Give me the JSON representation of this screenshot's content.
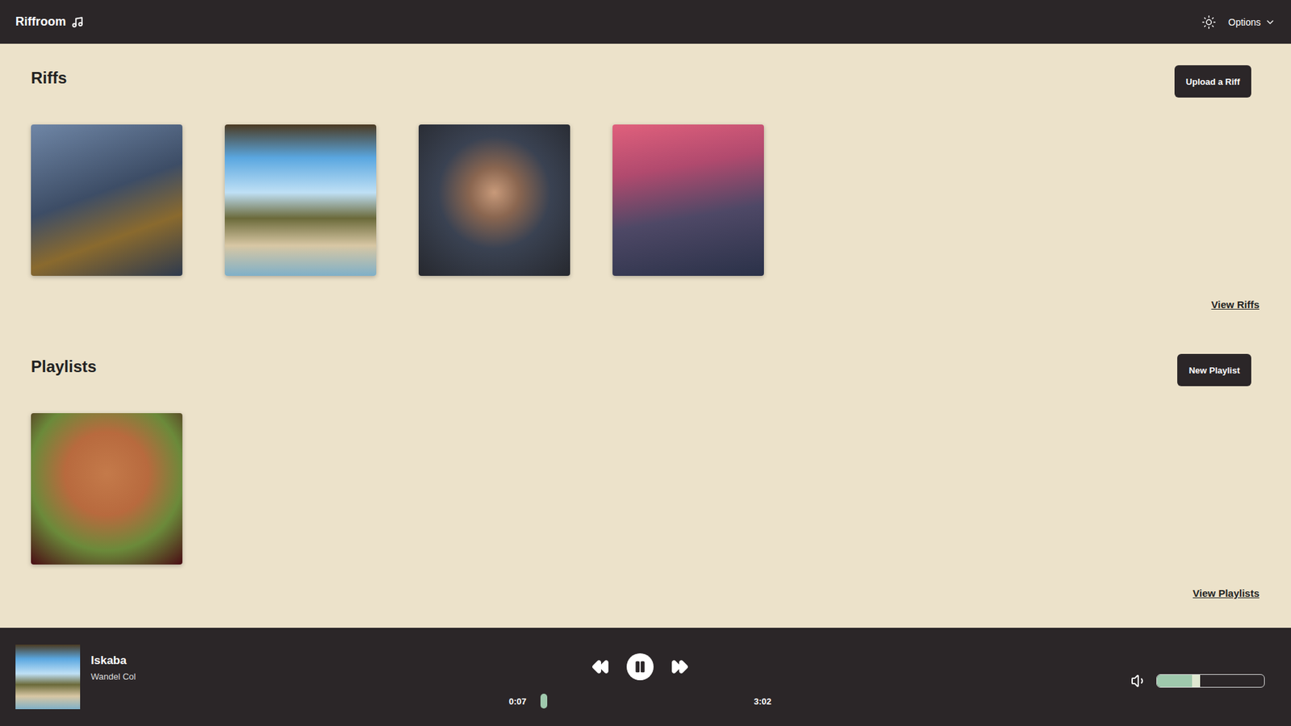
{
  "header": {
    "title": "Riffroom",
    "options": "Options"
  },
  "riffs": {
    "title": "Riffs",
    "button": "Upload a Riff",
    "link": "View Riffs",
    "items": [
      {
        "image": "halo"
      },
      {
        "image": "beach"
      },
      {
        "image": "portrait"
      },
      {
        "image": "mountain"
      }
    ]
  },
  "playlists": {
    "title": "Playlists",
    "button": "New Playlist",
    "link": "View Playlists",
    "items": [
      {
        "image": "cartoon"
      }
    ]
  },
  "player": {
    "title": "Iskaba",
    "artist": "Wandel Col",
    "image": "beach",
    "playing": true,
    "elapsed": "0:07",
    "duration": "3:02",
    "progress": 0.04,
    "volume": 0.4
  }
}
